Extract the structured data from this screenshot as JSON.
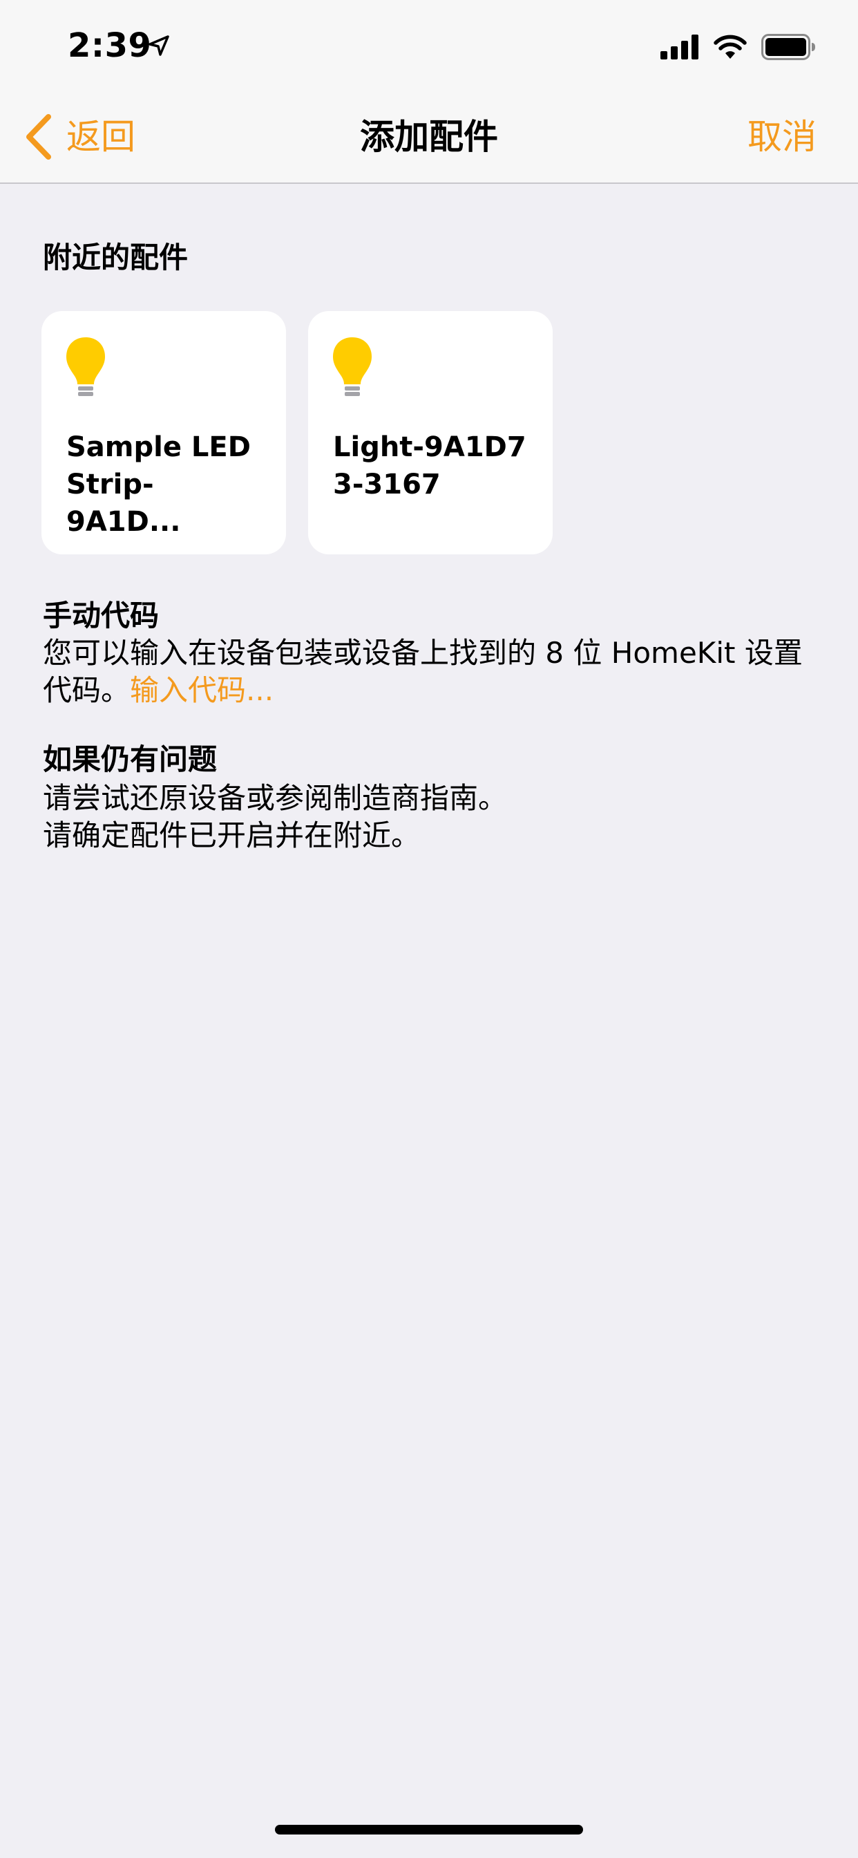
{
  "status_bar": {
    "time": "2:39",
    "icons": [
      "location-arrow-icon",
      "cellular-signal-icon",
      "wifi-icon",
      "battery-icon"
    ]
  },
  "nav": {
    "back_label": "返回",
    "title": "添加配件",
    "cancel_label": "取消",
    "accent_color": "#F49A1E"
  },
  "nearby": {
    "title": "附近的配件",
    "accessories": [
      {
        "name": "Sample LED\nStrip-9A1D...",
        "icon": "lightbulb-icon"
      },
      {
        "name": "Light-9A1D7\n3-3167",
        "icon": "lightbulb-icon"
      }
    ]
  },
  "manual": {
    "title": "手动代码",
    "body": "您可以输入在设备包装或设备上找到的 8 位 HomeKit 设置代码。",
    "link": "输入代码..."
  },
  "trouble": {
    "title": "如果仍有问题",
    "line1": "请尝试还原设备或参阅制造商指南。",
    "line2": "请确定配件已开启并在附近。"
  }
}
